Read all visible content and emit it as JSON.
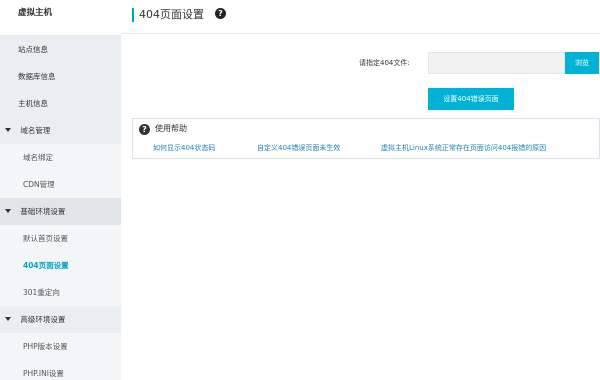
{
  "sidebar": {
    "title": "虚拟主机",
    "items": [
      {
        "label": "站点信息"
      },
      {
        "label": "数据库信息"
      },
      {
        "label": "主机信息"
      },
      {
        "label": "域名管理"
      },
      {
        "label": "域名绑定"
      },
      {
        "label": "CDN管理"
      },
      {
        "label": "基础环境设置"
      },
      {
        "label": "默认首页设置"
      },
      {
        "label": "404页面设置"
      },
      {
        "label": "301重定向"
      },
      {
        "label": "高级环境设置"
      },
      {
        "label": "PHP版本设置"
      },
      {
        "label": "PHP.INI设置"
      }
    ]
  },
  "header": {
    "title": "404页面设置",
    "help_glyph": "?"
  },
  "form": {
    "file_label": "请指定404文件:",
    "file_value": "",
    "browse_label": "浏览",
    "submit_label": "设置404错误页面"
  },
  "help": {
    "icon_glyph": "?",
    "title": "使用帮助",
    "links": [
      {
        "label": "如何显示404状态码"
      },
      {
        "label": "自定义404错误页面未生效"
      },
      {
        "label": "虚拟主机Linux系统正常存在页面访问404报错的原因"
      }
    ]
  },
  "colors": {
    "accent": "#00b3d6",
    "active_text": "#00a2ca",
    "link": "#1f7fb8",
    "sidebar_bg": "#eaedf1"
  }
}
